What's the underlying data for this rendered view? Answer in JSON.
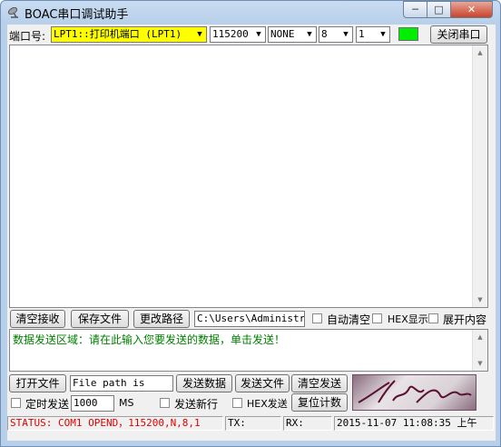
{
  "window": {
    "title": "BOAC串口调试助手"
  },
  "port_bar": {
    "port_label": "端口号:",
    "port_value": "LPT1::打印机端口 (LPT1)",
    "baud_value": "115200",
    "parity_value": "NONE",
    "databits_value": "8",
    "stopbits_value": "1",
    "indicator_color": "#00ee00",
    "close_port_label": "关闭串口"
  },
  "receive_toolbar": {
    "clear_label": "清空接收",
    "save_label": "保存文件",
    "path_change_label": "更改路径",
    "path_value": "C:\\Users\\Administrat",
    "auto_clear_label": "自动清空",
    "hex_display_label": "HEX显示",
    "expand_label": "展开内容"
  },
  "send_area": {
    "hint": "数据发送区域：请在此输入您要发送的数据，单击发送！"
  },
  "send_toolbar": {
    "open_file_label": "打开文件",
    "file_path_value": "File path is",
    "send_data_label": "发送数据",
    "send_file_label": "发送文件",
    "clear_send_label": "清空发送",
    "timed_send_label": "定时发送",
    "interval_value": "1000",
    "interval_unit": "MS",
    "send_newline_label": "发送新行",
    "hex_send_label": "HEX发送",
    "reset_count_label": "复位计数"
  },
  "status": {
    "status_text": "STATUS: COM1 OPEND，115200,N,8,1",
    "tx_label": "TX:",
    "rx_label": "RX:",
    "datetime": "2015-11-07   11:08:35 上午"
  }
}
